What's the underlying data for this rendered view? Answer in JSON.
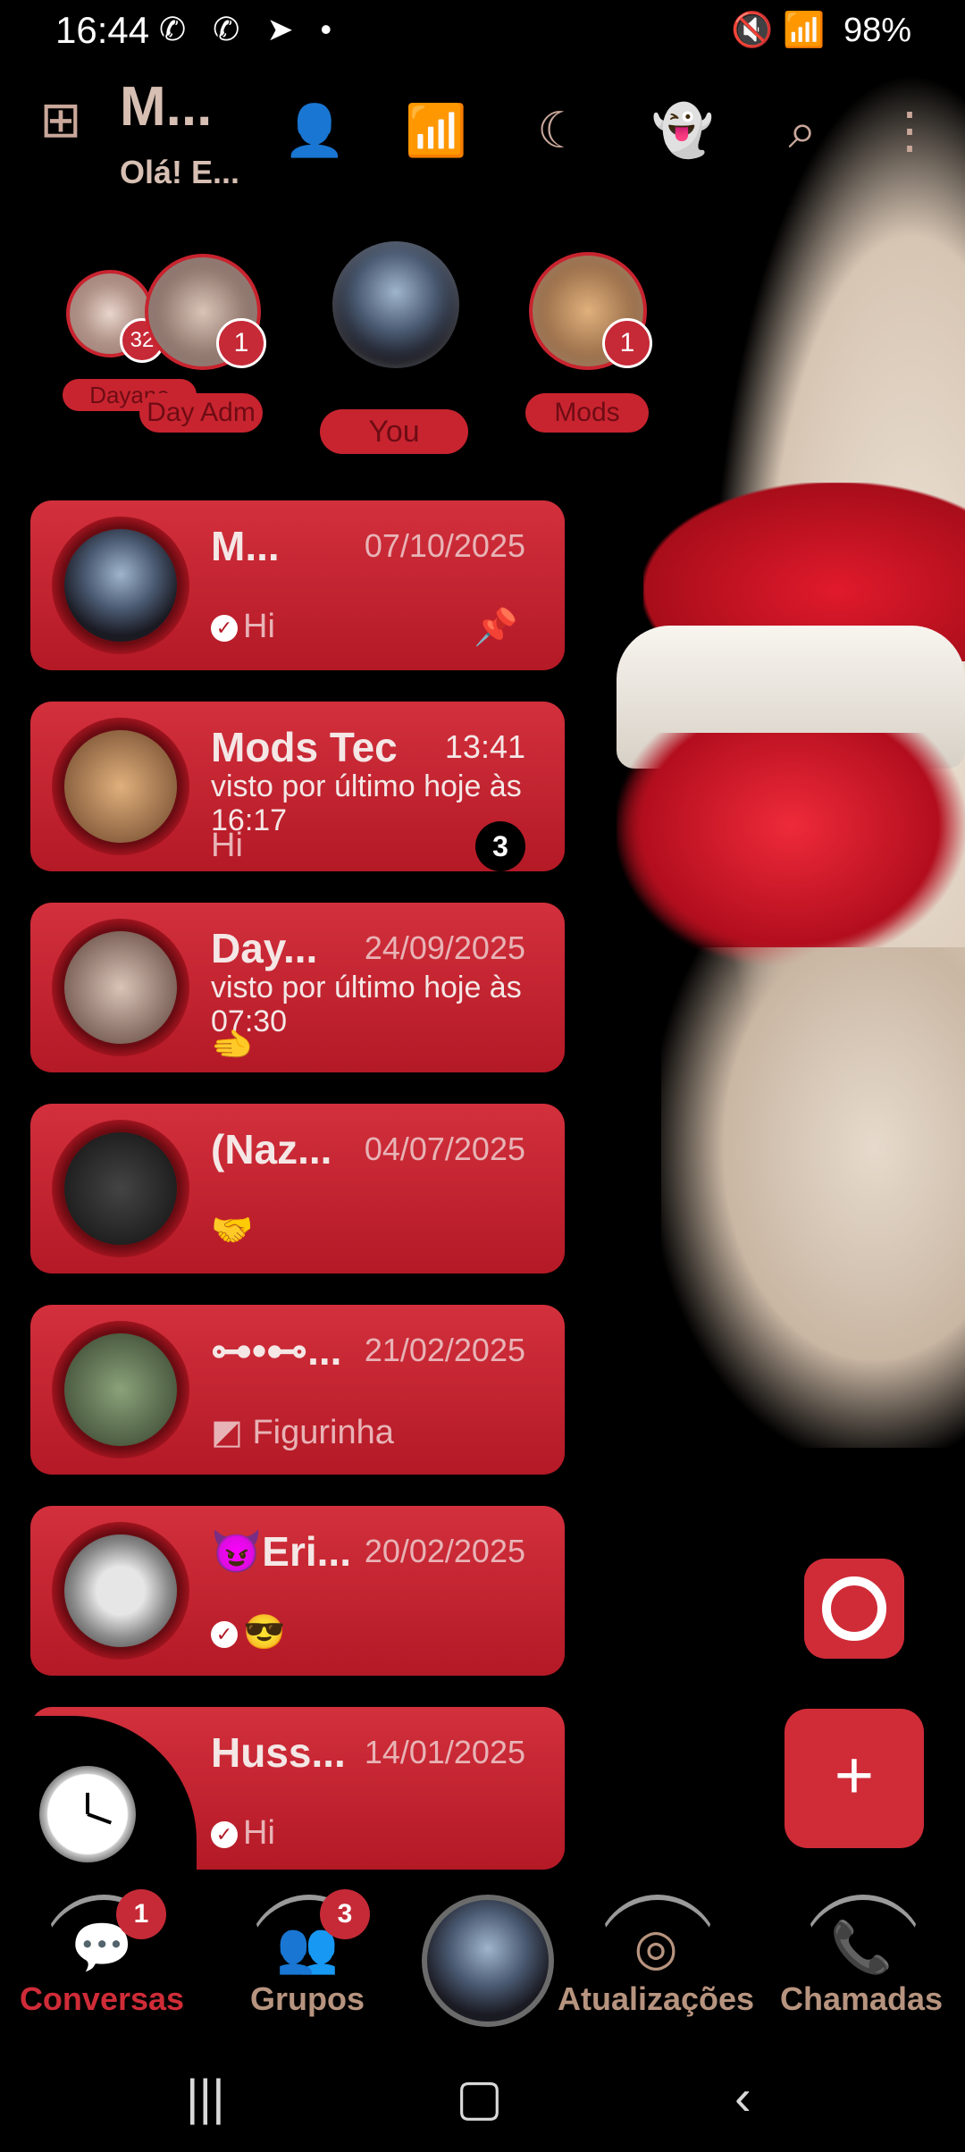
{
  "status_bar": {
    "time": "16:44",
    "left_icons": "✆ ✆ ➤ •",
    "right_icons": "🔇 📶",
    "battery": "98%"
  },
  "header": {
    "title": "M...",
    "subtitle": "Olá! E...",
    "icons": [
      "apps-icon",
      "add-contact-icon",
      "wifi-icon",
      "dark-mode-icon",
      "ghost-icon",
      "search-icon",
      "more-vert-icon"
    ]
  },
  "stories": [
    {
      "label": "Dayane",
      "badge": "32"
    },
    {
      "label": "Day Adm",
      "badge": "1"
    },
    {
      "label": "You",
      "badge": ""
    },
    {
      "label": "Mods",
      "badge": "1"
    }
  ],
  "chats": [
    {
      "name": "M...",
      "date": "07/10/2025",
      "status": "",
      "message": "Hi",
      "read_tick": true,
      "pinned": true,
      "unread": ""
    },
    {
      "name": "Mods Tec",
      "date": "13:41",
      "status": "visto por último hoje às 16:17",
      "message": "Hi",
      "read_tick": false,
      "pinned": false,
      "unread": "3"
    },
    {
      "name": "Day...",
      "date": "24/09/2025",
      "status": "visto por último hoje às 07:30",
      "message": "🫲",
      "read_tick": false,
      "pinned": false,
      "unread": ""
    },
    {
      "name": "(Naz...",
      "date": "04/07/2025",
      "status": "",
      "message": "🤝",
      "read_tick": false,
      "pinned": false,
      "unread": ""
    },
    {
      "name": "⊶•⊷...",
      "date": "21/02/2025",
      "status": "",
      "message": "Figurinha",
      "read_tick": false,
      "pinned": false,
      "unread": ""
    },
    {
      "name": "😈Eri...",
      "date": "20/02/2025",
      "status": "",
      "message": "😎",
      "read_tick": true,
      "pinned": false,
      "unread": ""
    },
    {
      "name": "Huss...",
      "date": "14/01/2025",
      "status": "",
      "message": "Hi",
      "read_tick": true,
      "pinned": false,
      "unread": ""
    }
  ],
  "fab": {
    "new_chat": "+"
  },
  "bottom_nav": [
    {
      "label": "Conversas",
      "badge": "1",
      "icon": "chat-icon"
    },
    {
      "label": "Grupos",
      "badge": "3",
      "icon": "groups-icon"
    },
    {
      "label": "Atualizações",
      "badge": "",
      "icon": "status-icon"
    },
    {
      "label": "Chamadas",
      "badge": "",
      "icon": "calls-icon"
    }
  ],
  "colors": {
    "accent": "#cf2c38",
    "card": "#c2222f",
    "muted_text": "#b7947f"
  }
}
